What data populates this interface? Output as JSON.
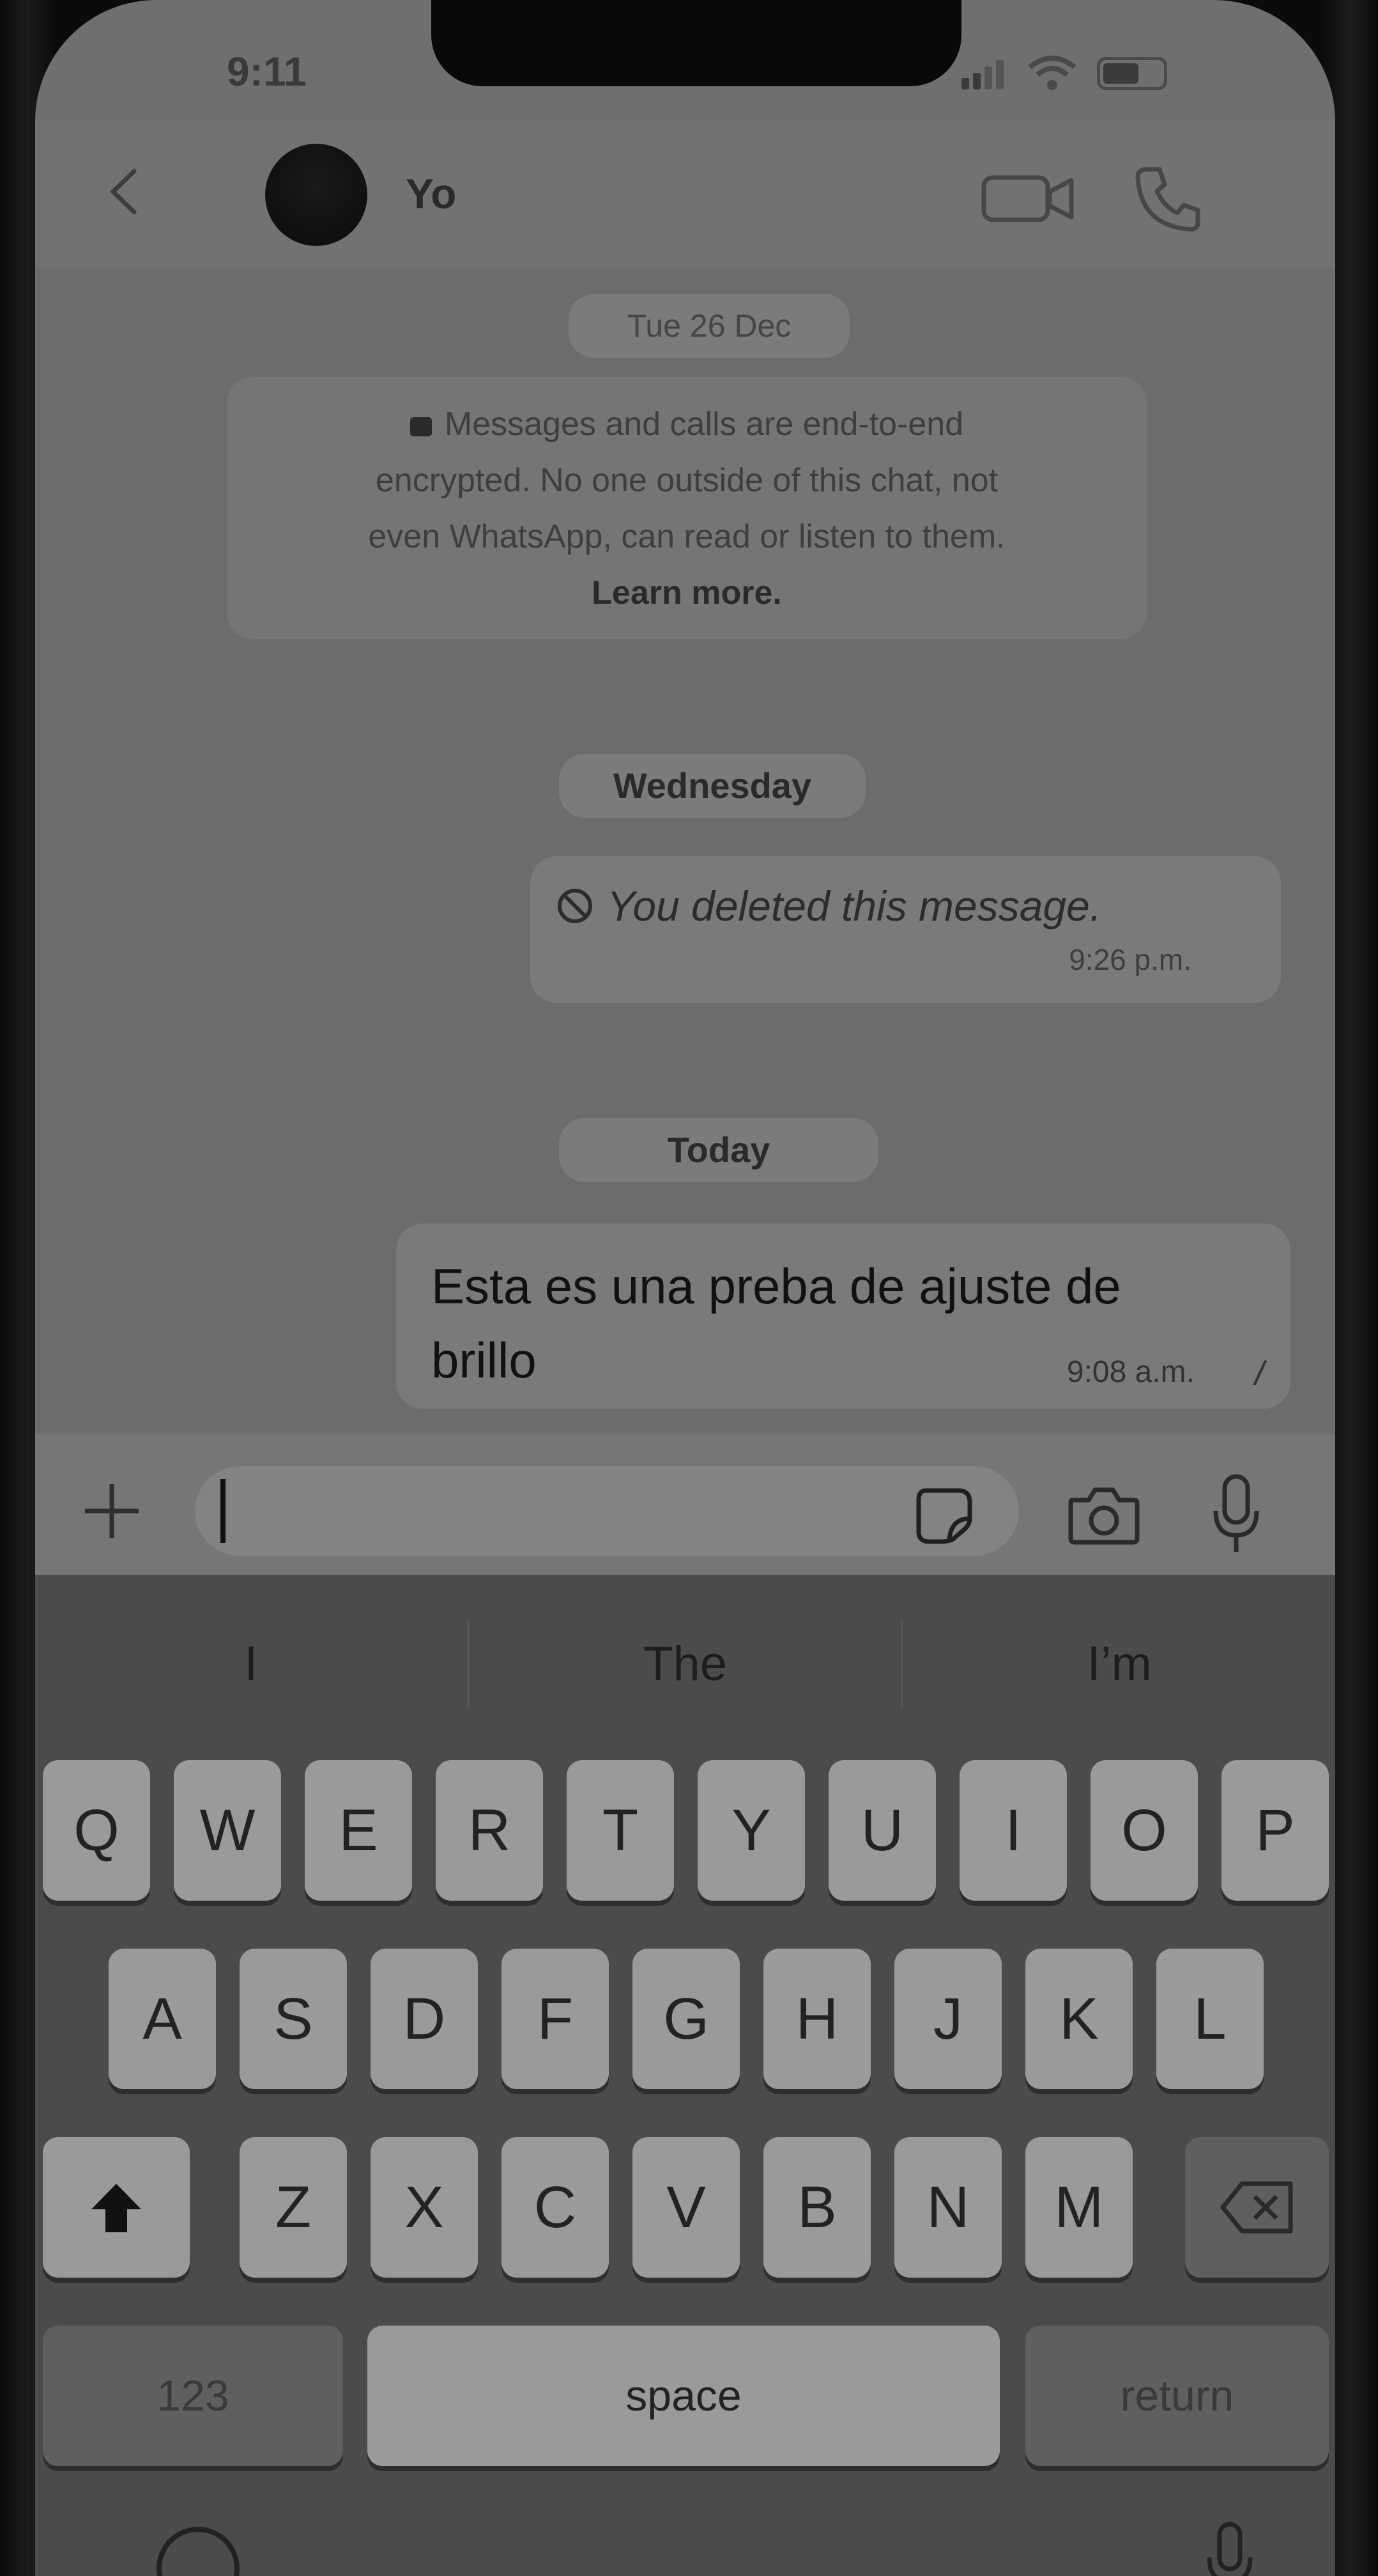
{
  "status_bar": {
    "time": "9:11"
  },
  "header": {
    "contact_name": "Yo",
    "icons": [
      "back-icon",
      "video-call-icon",
      "phone-call-icon"
    ]
  },
  "chat": {
    "date_pills": {
      "first": "Tue 26 Dec",
      "second": "Wednesday",
      "third": "Today"
    },
    "encryption_notice": {
      "line1": "Messages and calls are end-to-end",
      "line2": "encrypted. No one outside of this chat, not",
      "line3": "even WhatsApp, can read or listen to them.",
      "link": "Learn more."
    },
    "deleted_message": {
      "text": "You deleted this message.",
      "time": "9:26 p.m."
    },
    "sent_message": {
      "text": "Esta es una preba de ajuste de brillo",
      "time": "9:08 a.m.",
      "ticks": "//"
    }
  },
  "input_bar": {
    "value": "",
    "placeholder": ""
  },
  "keyboard": {
    "suggestions": [
      "I",
      "The",
      "I’m"
    ],
    "row1": [
      "Q",
      "W",
      "E",
      "R",
      "T",
      "Y",
      "U",
      "I",
      "O",
      "P"
    ],
    "row2": [
      "A",
      "S",
      "D",
      "F",
      "G",
      "H",
      "J",
      "K",
      "L"
    ],
    "row3": [
      "Z",
      "X",
      "C",
      "V",
      "B",
      "N",
      "M"
    ],
    "numbers_label": "123",
    "space_label": "space",
    "return_label": "return"
  },
  "colors": {
    "screen": "#6f6f6f",
    "bubble": "#7a7a7a",
    "keyboard": "#4b4b4b",
    "key": "#9a9a9a"
  }
}
